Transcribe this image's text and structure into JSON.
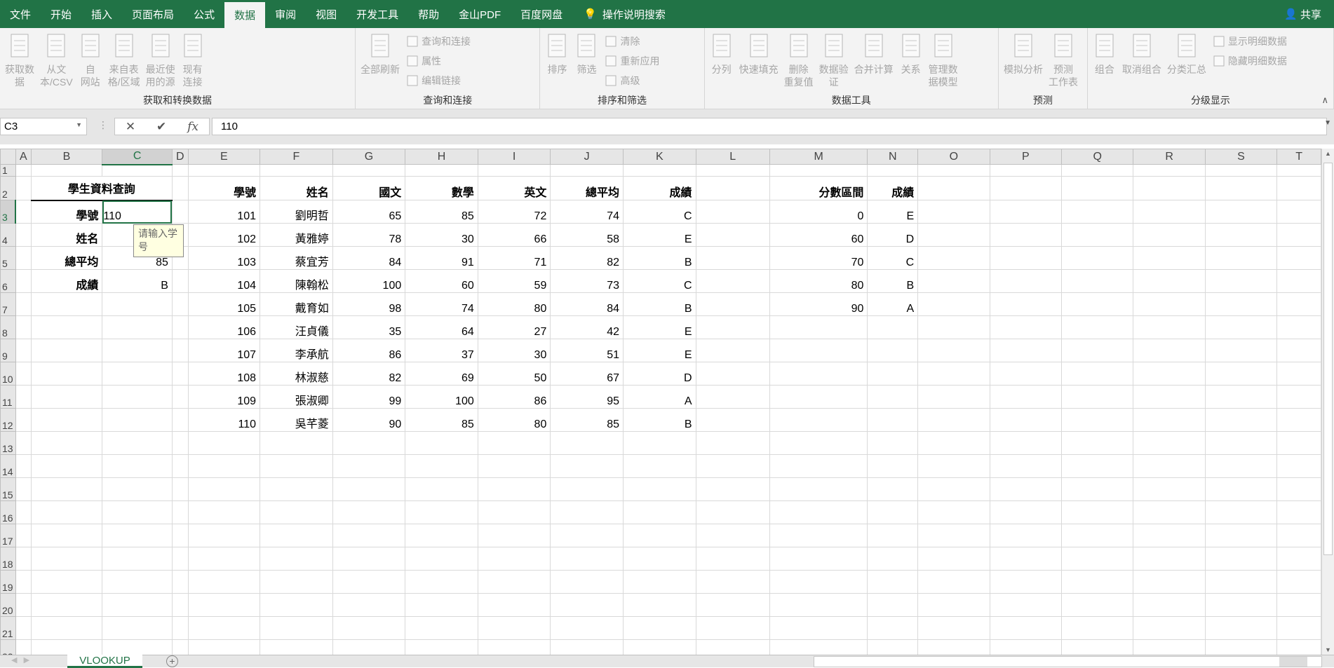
{
  "tabs": [
    "文件",
    "开始",
    "插入",
    "页面布局",
    "公式",
    "数据",
    "审阅",
    "视图",
    "开发工具",
    "帮助",
    "金山PDF",
    "百度网盘"
  ],
  "active_tab": "数据",
  "search_label": "操作说明搜索",
  "share_label": "共享",
  "ribbon": {
    "groups": [
      {
        "label": "获取和转换数据",
        "big": [
          "获取数\n据",
          "从文\n本/CSV",
          "自\n网站",
          "来自表\n格/区域",
          "最近使\n用的源",
          "现有\n连接"
        ],
        "small": []
      },
      {
        "label": "查询和连接",
        "big": [
          "全部刷新"
        ],
        "small": [
          "查询和连接",
          "属性",
          "编辑链接"
        ]
      },
      {
        "label": "排序和筛选",
        "big": [
          "排序",
          "筛选"
        ],
        "small": [
          "清除",
          "重新应用",
          "高级"
        ]
      },
      {
        "label": "数据工具",
        "big": [
          "分列",
          "快速填充",
          "删除\n重复值",
          "数据验\n证",
          "合并计算",
          "关系",
          "管理数\n据模型"
        ],
        "small": []
      },
      {
        "label": "预测",
        "big": [
          "模拟分析",
          "预测\n工作表"
        ],
        "small": []
      },
      {
        "label": "分级显示",
        "big": [
          "组合",
          "取消组合",
          "分类汇总"
        ],
        "small": [
          "显示明细数据",
          "隐藏明细数据"
        ]
      }
    ]
  },
  "formula_bar": {
    "name_box": "C3",
    "value": "110"
  },
  "columns": [
    "A",
    "B",
    "C",
    "D",
    "E",
    "F",
    "G",
    "H",
    "I",
    "J",
    "K",
    "L",
    "M",
    "N",
    "O",
    "P",
    "Q",
    "R",
    "S",
    "T"
  ],
  "selected_cell": "C3",
  "cells": {
    "B2": "學生資料查詢",
    "B3": "學號",
    "C3": "110",
    "B4": "姓名",
    "B5": "總平均",
    "C5": "85",
    "B6": "成績",
    "C6": "B",
    "E2": "學號",
    "F2": "姓名",
    "G2": "國文",
    "H2": "數學",
    "I2": "英文",
    "J2": "總平均",
    "K2": "成績",
    "E3": "101",
    "F3": "劉明哲",
    "G3": "65",
    "H3": "85",
    "I3": "72",
    "J3": "74",
    "K3": "C",
    "E4": "102",
    "F4": "黃雅婷",
    "G4": "78",
    "H4": "30",
    "I4": "66",
    "J4": "58",
    "K4": "E",
    "E5": "103",
    "F5": "蔡宜芳",
    "G5": "84",
    "H5": "91",
    "I5": "71",
    "J5": "82",
    "K5": "B",
    "E6": "104",
    "F6": "陳翰松",
    "G6": "100",
    "H6": "60",
    "I6": "59",
    "J6": "73",
    "K6": "C",
    "E7": "105",
    "F7": "戴育如",
    "G7": "98",
    "H7": "74",
    "I7": "80",
    "J7": "84",
    "K7": "B",
    "E8": "106",
    "F8": "汪貞儀",
    "G8": "35",
    "H8": "64",
    "I8": "27",
    "J8": "42",
    "K8": "E",
    "E9": "107",
    "F9": "李承航",
    "G9": "86",
    "H9": "37",
    "I9": "30",
    "J9": "51",
    "K9": "E",
    "E10": "108",
    "F10": "林淑慈",
    "G10": "82",
    "H10": "69",
    "I10": "50",
    "J10": "67",
    "K10": "D",
    "E11": "109",
    "F11": "張淑卿",
    "G11": "99",
    "H11": "100",
    "I11": "86",
    "J11": "95",
    "K11": "A",
    "E12": "110",
    "F12": "吳芊菱",
    "G12": "90",
    "H12": "85",
    "I12": "80",
    "J12": "85",
    "K12": "B",
    "M2": "分數區間",
    "N2": "成績",
    "M3": "0",
    "N3": "E",
    "M4": "60",
    "N4": "D",
    "M5": "70",
    "N5": "C",
    "M6": "80",
    "N6": "B",
    "M7": "90",
    "N7": "A"
  },
  "tooltip": "请输入学号",
  "sheet_tab": "VLOOKUP",
  "row_count": 22
}
